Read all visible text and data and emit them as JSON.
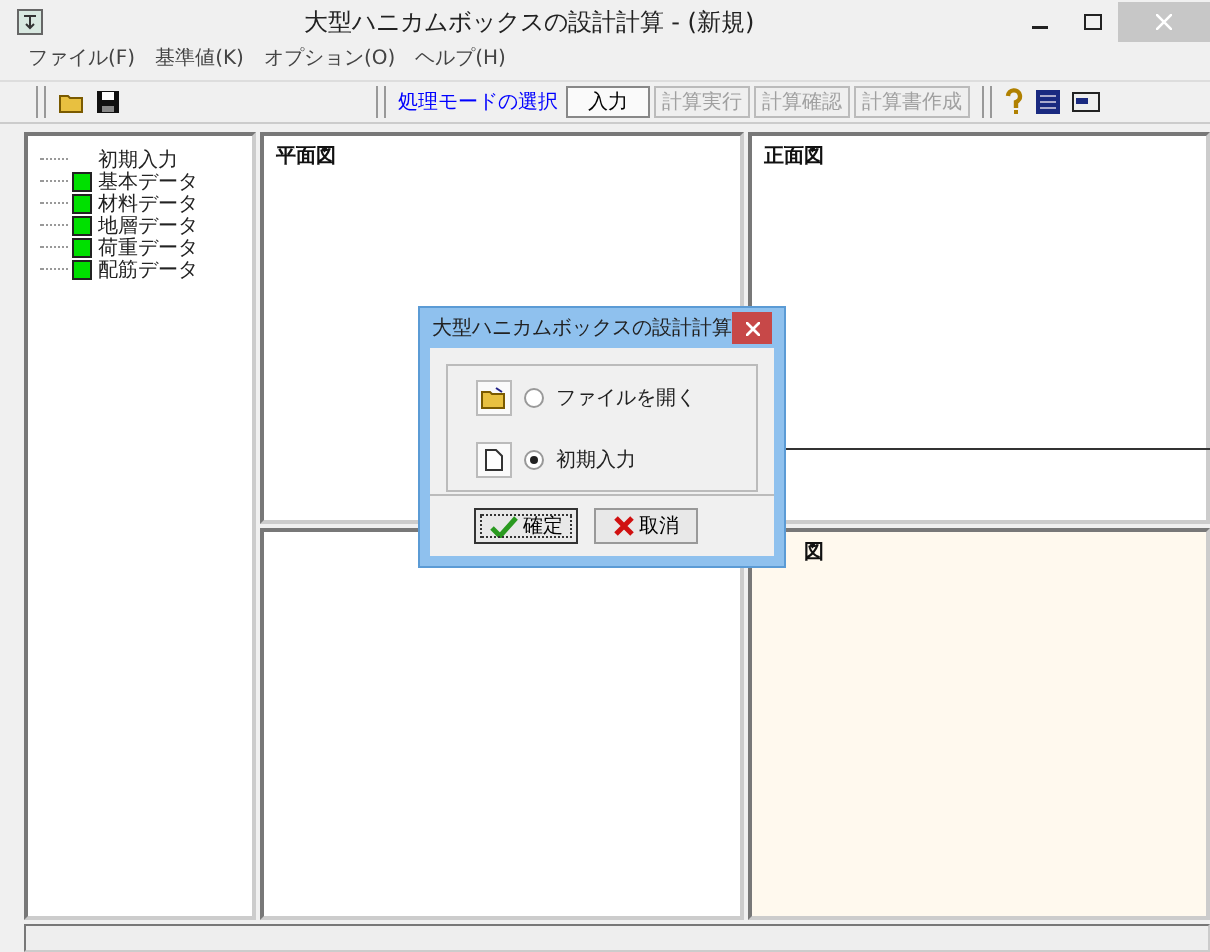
{
  "window": {
    "title": "大型ハニカムボックスの設計計算 - (新規)"
  },
  "menu": [
    "ファイル(F)",
    "基準値(K)",
    "オプション(O)",
    "ヘルプ(H)"
  ],
  "toolbar": {
    "mode_label": "処理モードの選択",
    "modes": [
      {
        "label": "入力",
        "disabled": false,
        "selected": true
      },
      {
        "label": "計算実行",
        "disabled": true,
        "selected": false
      },
      {
        "label": "計算確認",
        "disabled": true,
        "selected": false
      },
      {
        "label": "計算書作成",
        "disabled": true,
        "selected": false
      }
    ]
  },
  "tree": [
    {
      "label": "初期入力",
      "marked": false
    },
    {
      "label": "基本データ",
      "marked": true
    },
    {
      "label": "材料データ",
      "marked": true
    },
    {
      "label": "地層データ",
      "marked": true
    },
    {
      "label": "荷重データ",
      "marked": true
    },
    {
      "label": "配筋データ",
      "marked": true
    }
  ],
  "panes": [
    {
      "title": "平面図",
      "tinted": false
    },
    {
      "title": "正面図",
      "tinted": false
    },
    {
      "tinted": false
    },
    {
      "title": "図",
      "tinted": true
    }
  ],
  "dialog": {
    "title": "大型ハニカムボックスの設計計算",
    "options": [
      {
        "label": "ファイルを開く",
        "selected": false
      },
      {
        "label": "初期入力",
        "selected": true
      }
    ],
    "buttons": [
      {
        "label": "確定",
        "kind": "ok"
      },
      {
        "label": "取消",
        "kind": "cancel"
      }
    ]
  }
}
